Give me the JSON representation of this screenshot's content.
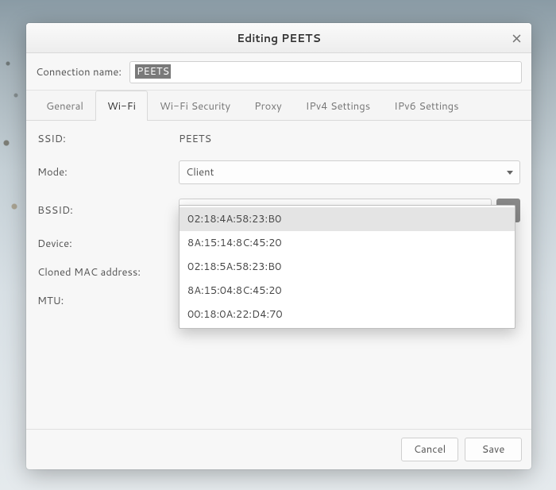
{
  "titlebar": {
    "title": "Editing PEETS"
  },
  "name_row": {
    "label": "Connection name:",
    "value": "PEETS"
  },
  "tabs": [
    {
      "label": "General",
      "active": false
    },
    {
      "label": "Wi-Fi",
      "active": true
    },
    {
      "label": "Wi-Fi Security",
      "active": false
    },
    {
      "label": "Proxy",
      "active": false
    },
    {
      "label": "IPv4 Settings",
      "active": false
    },
    {
      "label": "IPv6 Settings",
      "active": false
    }
  ],
  "form": {
    "ssid": {
      "label": "SSID:",
      "value": "PEETS"
    },
    "mode": {
      "label": "Mode:",
      "value": "Client"
    },
    "bssid": {
      "label": "BSSID:",
      "value": ""
    },
    "device": {
      "label": "Device:",
      "value": ""
    },
    "cloned_mac": {
      "label": "Cloned MAC address:",
      "value": ""
    },
    "mtu": {
      "label": "MTU:",
      "value": ""
    }
  },
  "bssid_dropdown": {
    "open": true,
    "options": [
      "02:18:4A:58:23:B0",
      "8A:15:14:8C:45:20",
      "02:18:5A:58:23:B0",
      "8A:15:04:8C:45:20",
      "00:18:0A:22:D4:70"
    ],
    "highlighted_index": 0
  },
  "footer": {
    "cancel": "Cancel",
    "save": "Save"
  }
}
